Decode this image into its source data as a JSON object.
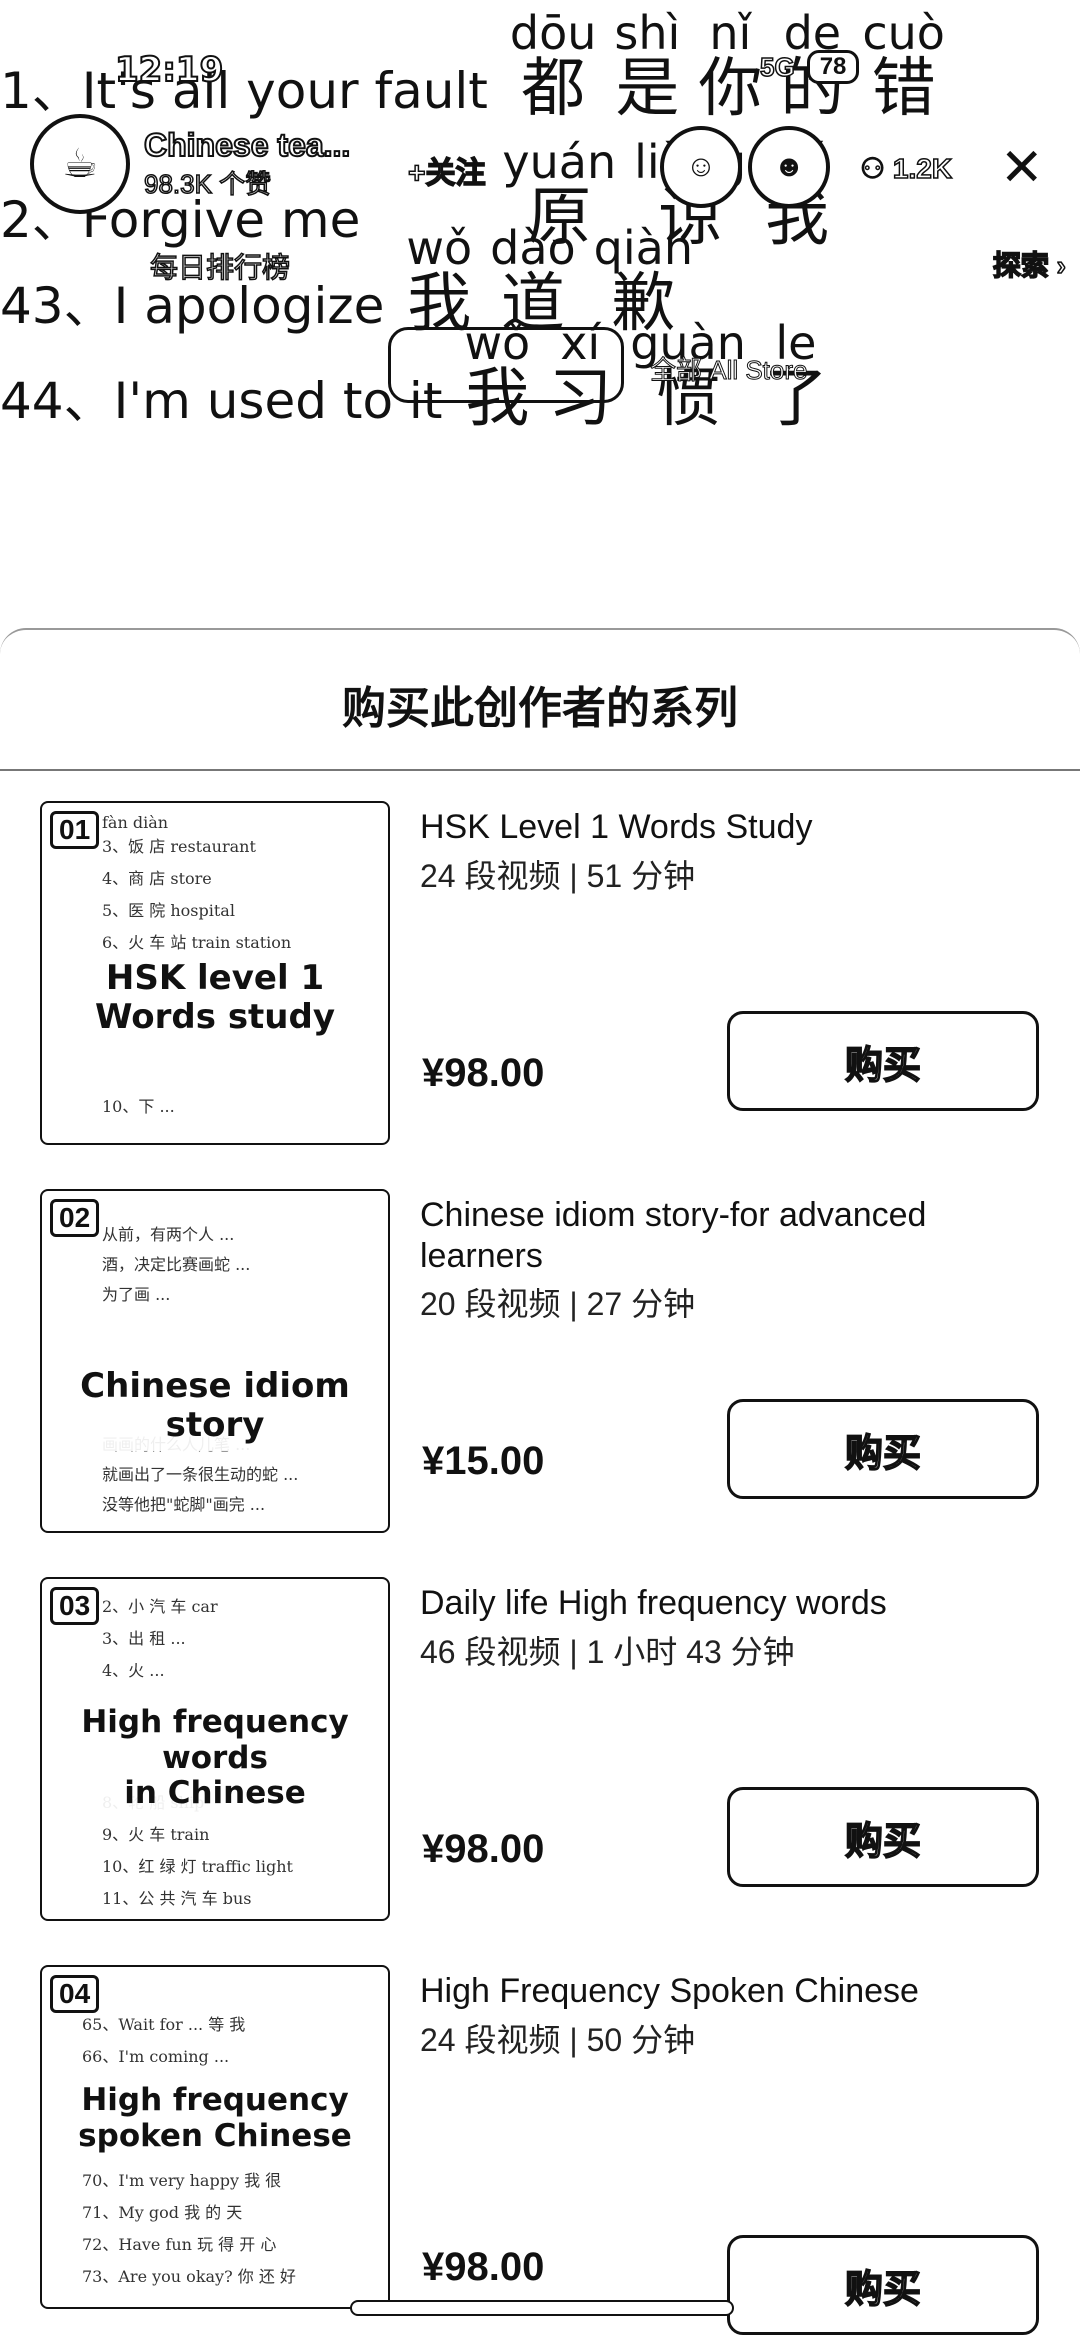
{
  "video": {
    "lines": [
      {
        "en": "1、It's all your fault",
        "chars": [
          {
            "py": "dōu",
            "ch": "都"
          },
          {
            "py": "shì",
            "ch": "是"
          },
          {
            "py": "nǐ",
            "ch": "你"
          },
          {
            "py": "de",
            "ch": "的"
          },
          {
            "py": "cuò",
            "ch": "错"
          }
        ]
      },
      {
        "en": "2、Forgive me",
        "chars": [
          {
            "py": "yuán",
            "ch": "原"
          },
          {
            "py": "liàng",
            "ch": "谅"
          },
          {
            "py": "wǒ",
            "ch": "我"
          }
        ]
      },
      {
        "en": "43、I apologize",
        "chars": [
          {
            "py": "wǒ",
            "ch": "我"
          },
          {
            "py": "dào",
            "ch": "道"
          },
          {
            "py": "qiàn",
            "ch": "歉"
          }
        ]
      },
      {
        "en": "44、I'm used to it",
        "chars": [
          {
            "py": "wǒ",
            "ch": "我"
          },
          {
            "py": "xí",
            "ch": "习"
          },
          {
            "py": "guàn",
            "ch": "惯"
          },
          {
            "py": "le",
            "ch": "了"
          }
        ]
      }
    ]
  },
  "status_bar": {
    "time": "12:19",
    "network": "5G",
    "battery": "78"
  },
  "live": {
    "anchor_name": "Chinese tea...",
    "likes": "98.3K 个赞",
    "follow_label": "+关注",
    "viewer_count": "1.2K",
    "hourly_rank": "每日排行榜",
    "explore_label": "探索 ›",
    "goods_text": "全部 All Store",
    "goods_sub": ""
  },
  "sheet": {
    "title": "购买此创作者的系列",
    "buy_label": "购买",
    "items": [
      {
        "num": "01",
        "cover_text": "HSK level 1\nWords study",
        "title": "HSK Level 1 Words Study",
        "meta": "24 段视频 | 51 分钟",
        "price": "¥98.00"
      },
      {
        "num": "02",
        "cover_text": "Chinese idiom story",
        "title": "Chinese idiom story-for advanced learners",
        "meta": "20 段视频 | 27 分钟",
        "price": "¥15.00"
      },
      {
        "num": "03",
        "cover_text": "High frequency words\nin Chinese",
        "title": "Daily life High frequency words",
        "meta": "46 段视频 | 1 小时 43 分钟",
        "price": "¥98.00"
      },
      {
        "num": "04",
        "cover_text": "High frequency\nspoken Chinese",
        "title": "High Frequency Spoken Chinese",
        "meta": "24 段视频 | 50 分钟",
        "price": "¥98.00"
      }
    ]
  },
  "icons": {
    "close": "close-icon",
    "user": "user-icon"
  }
}
